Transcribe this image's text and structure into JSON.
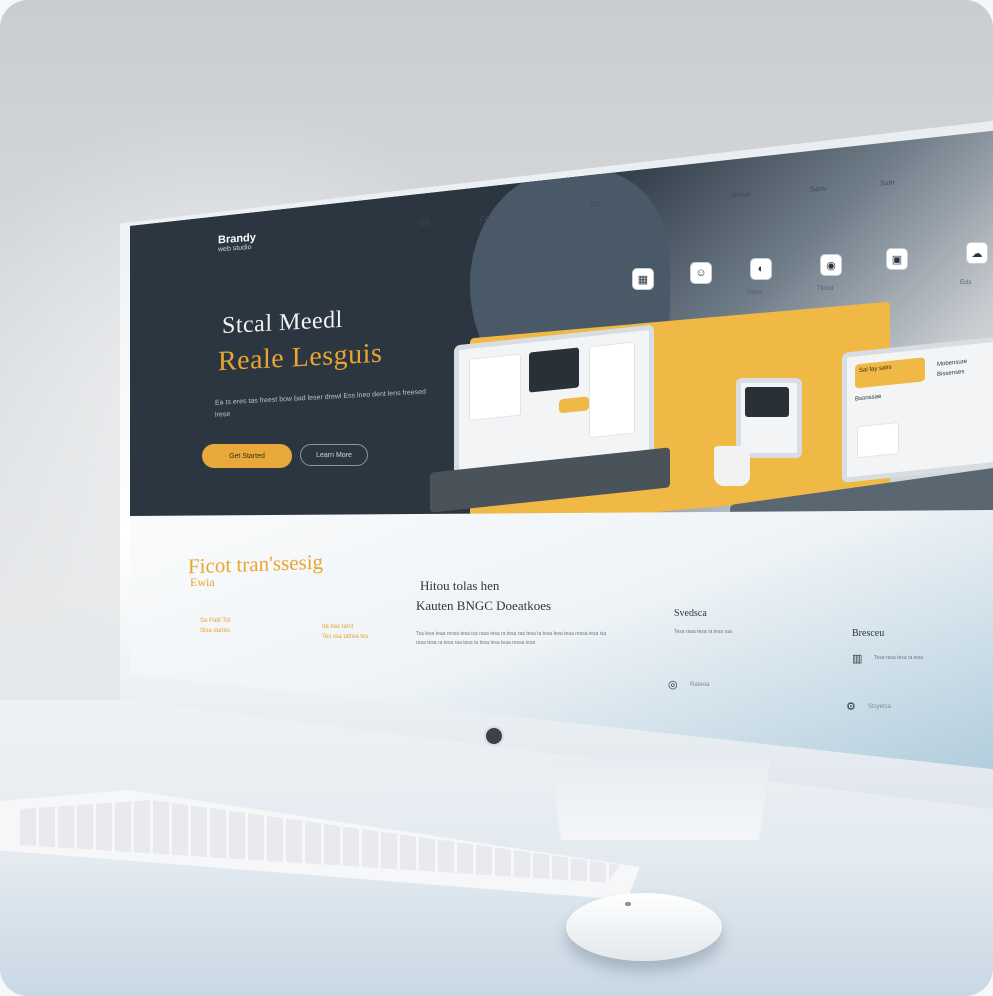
{
  "logo": {
    "name": "Brandy",
    "tagline": "web studio"
  },
  "hero": {
    "headline_1": "Stcal Meedl",
    "headline_2": "Reale Lesguis",
    "description": "Ea ts eres tas freest bow bad leser drewl Ess lneo dent lens freesed lrese",
    "primary_button": "Get Started",
    "secondary_button": "Learn More"
  },
  "nav": {
    "items": [
      "CS",
      "CA",
      "CO",
      "Sbrwd",
      "Sarw",
      "Sutn"
    ],
    "icon_captions": [
      "Tlsce",
      "Sarvs",
      "Tlcmd",
      "Ecls"
    ]
  },
  "mockup": {
    "card_title": "Sal fay salrs",
    "card_lines": [
      "Bsonssae",
      "Mobensure",
      "Bissenses"
    ]
  },
  "features": {
    "title": "Ficot tran'ssesig",
    "subtitle": "Ewia",
    "left_items": [
      "Sa Paltl Tot",
      "Slsa dartes",
      "Ita bas tarst",
      "Tes rea tatrea tes"
    ],
    "middle_title_1": "Hitou tolas hen",
    "middle_title_2": "Kauten BNGC Doeatkoes",
    "middle_text": "Tsa lesa teaa ressa tesa isa rasa tesa ra tesa raa tesa ta tesa lesa teaa ressa tesa isa rasa tesa ra tesa raa tesa ta tesa lesa teaa ressa tesa",
    "col3_title": "Svedsca",
    "col3_text": "Tesa rasa tesa ra tesa raa",
    "col3_link": "Rateoa",
    "col4_title": "Bresceu",
    "col4_text": "Tesa rasa tesa ra tesa",
    "col4_link": "Stsyetsa"
  },
  "colors": {
    "accent": "#e8a531",
    "dark": "#2b3640",
    "light": "#f3f4f5"
  }
}
